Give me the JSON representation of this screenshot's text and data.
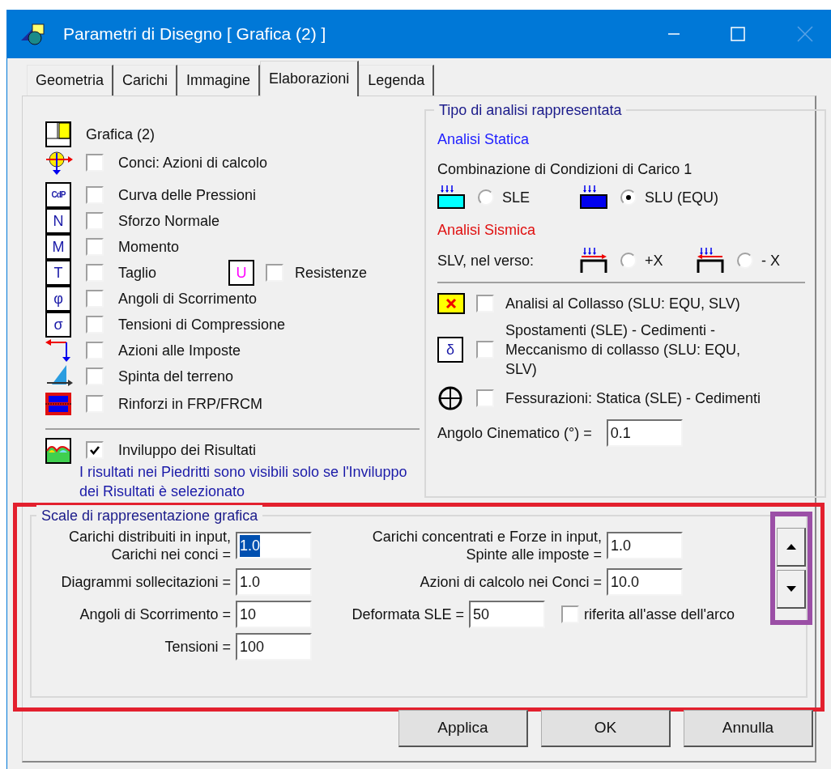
{
  "window": {
    "title": "Parametri di Disegno [ Grafica (2) ]"
  },
  "tabs": [
    {
      "label": "Geometria",
      "selected": false
    },
    {
      "label": "Carichi",
      "selected": false
    },
    {
      "label": "Immagine",
      "selected": false
    },
    {
      "label": "Elaborazioni",
      "selected": true
    },
    {
      "label": "Legenda",
      "selected": false
    }
  ],
  "left": {
    "header": {
      "kind": "grafica",
      "label": "Grafica (2)"
    },
    "options": [
      {
        "kind": "conci",
        "label": "Conci: Azioni di calcolo",
        "checked": false
      },
      {
        "kind": "letter",
        "symbol": "CdP",
        "label": "Curva delle Pressioni",
        "checked": false
      },
      {
        "kind": "letter",
        "symbol": "N",
        "label": "Sforzo Normale",
        "checked": false
      },
      {
        "kind": "letter",
        "symbol": "M",
        "label": "Momento",
        "checked": false
      },
      {
        "kind": "letter",
        "symbol": "T",
        "label": "Taglio",
        "checked": false,
        "extra": {
          "symbol": "U",
          "label": "Resistenze",
          "checked": false
        }
      },
      {
        "kind": "letter",
        "symbol": "φ",
        "label": "Angoli di Scorrimento",
        "checked": false
      },
      {
        "kind": "letter",
        "symbol": "σ",
        "label": "Tensioni di Compressione",
        "checked": false
      },
      {
        "kind": "imposte",
        "label": "Azioni alle Imposte",
        "checked": false
      },
      {
        "kind": "spinta",
        "label": "Spinta del terreno",
        "checked": false
      },
      {
        "kind": "frp",
        "label": "Rinforzi in FRP/FRCM",
        "checked": false
      }
    ],
    "envelope": {
      "label": "Inviluppo dei Risultati",
      "checked": true,
      "note": "I risultati nei Piedritti sono visibili solo se l'Inviluppo dei Risultati è selezionato"
    }
  },
  "analysis": {
    "title": "Tipo di analisi rappresentata",
    "static_title": "Analisi Statica",
    "combination": "Combinazione di Condizioni di Carico 1",
    "static_radios": [
      {
        "kind": "sle",
        "label": "SLE",
        "selected": false
      },
      {
        "kind": "slu",
        "label": "SLU (EQU)",
        "selected": true
      }
    ],
    "seismic_title": "Analisi Sismica",
    "seismic_label": "SLV, nel verso:",
    "seismic_radios": [
      {
        "kind": "plus",
        "label": "+X",
        "selected": false
      },
      {
        "kind": "minus",
        "label": "- X",
        "selected": false
      }
    ],
    "options": [
      {
        "kind": "collasso",
        "label": "Analisi al Collasso (SLU: EQU, SLV)",
        "checked": false
      },
      {
        "kind": "letter",
        "symbol": "δ",
        "label": "Spostamenti (SLE) - Cedimenti - Meccanismo di collasso (SLU: EQU, SLV)",
        "checked": false
      },
      {
        "kind": "fessure",
        "label": "Fessurazioni: Statica (SLE) - Cedimenti",
        "checked": false
      }
    ],
    "angle": {
      "label": "Angolo Cinematico (°) =",
      "value": "0.1"
    }
  },
  "scales": {
    "title": "Scale di rappresentazione grafica",
    "left_fields": [
      {
        "label": "Carichi distribuiti in input,\nCarichi nei conci =",
        "value": "1.0",
        "selected": true
      },
      {
        "label": "Diagrammi sollecitazioni =",
        "value": "1.0",
        "selected": false
      },
      {
        "label": "Angoli di Scorrimento =",
        "value": "10",
        "selected": false
      },
      {
        "label": "Tensioni =",
        "value": "100",
        "selected": false
      }
    ],
    "right_fields": [
      {
        "label": "Carichi concentrati e Forze in input,\nSpinte alle imposte =",
        "value": "1.0",
        "selected": false
      },
      {
        "label": "Azioni di calcolo nei Conci =",
        "value": "10.0",
        "selected": false
      },
      {
        "label": "Deformata SLE =",
        "value": "50",
        "selected": false
      }
    ],
    "axis_option": {
      "label": "riferita all'asse dell'arco",
      "checked": false
    }
  },
  "buttons": [
    "Applica",
    "OK",
    "Annulla"
  ]
}
